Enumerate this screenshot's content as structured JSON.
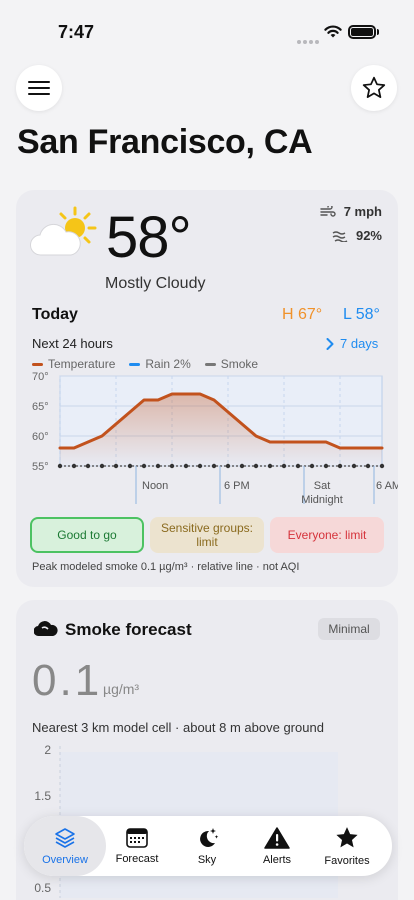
{
  "status_bar": {
    "time": "7:47"
  },
  "header": {
    "city": "San Francisco, CA"
  },
  "current": {
    "temperature": "58°",
    "condition": "Mostly Cloudy",
    "wind": "7 mph",
    "humidity": "92%",
    "today_label": "Today",
    "high": "H 67°",
    "low": "L 58°",
    "next_label": "Next 24 hours",
    "days_link": "7 days"
  },
  "legend": {
    "temperature": "Temperature",
    "rain": "Rain 2%",
    "smoke": "Smoke"
  },
  "colors": {
    "temperature": "#c2521d",
    "rain": "#1f8cf0",
    "smoke": "#777777",
    "high": "#f0922b",
    "low": "#1f8cf0"
  },
  "chart_data": {
    "type": "line",
    "y_tick_labels": [
      "70°",
      "65°",
      "60°",
      "55°"
    ],
    "ylim": [
      55,
      70
    ],
    "x_tick_labels": [
      "Noon",
      "6 PM",
      "Sat\nMidnight",
      "6 AM"
    ],
    "series": [
      {
        "name": "Temperature",
        "values": [
          58,
          58,
          59,
          60,
          62,
          64,
          66,
          66,
          67,
          67,
          67,
          66,
          64,
          62,
          60,
          59,
          59,
          59,
          59,
          59,
          58,
          58,
          58,
          58
        ]
      },
      {
        "name": "Smoke",
        "values": [
          55,
          55,
          55,
          55,
          55,
          55,
          55,
          55,
          55,
          55,
          55,
          55,
          55,
          55,
          55,
          55,
          55,
          55,
          55,
          55,
          55,
          55,
          55,
          55
        ]
      }
    ]
  },
  "badges": {
    "good": "Good to go",
    "sensitive": "Sensitive groups: limit",
    "everyone": "Everyone: limit"
  },
  "peak_note": "Peak modeled smoke 0.1 µg/m³ · relative line · not AQI",
  "smoke": {
    "title": "Smoke forecast",
    "level": "Minimal",
    "value": "0.1",
    "unit": "µg/m³",
    "location_note": "Nearest 3 km model cell · about 8 m above ground",
    "y_tick_labels": [
      "2",
      "1.5",
      "1",
      "0.5"
    ]
  },
  "tabs": [
    {
      "label": "Overview",
      "icon": "layers-icon"
    },
    {
      "label": "Forecast",
      "icon": "calendar-icon"
    },
    {
      "label": "Sky",
      "icon": "moon-stars-icon"
    },
    {
      "label": "Alerts",
      "icon": "alert-icon"
    },
    {
      "label": "Favorites",
      "icon": "star-icon"
    }
  ]
}
